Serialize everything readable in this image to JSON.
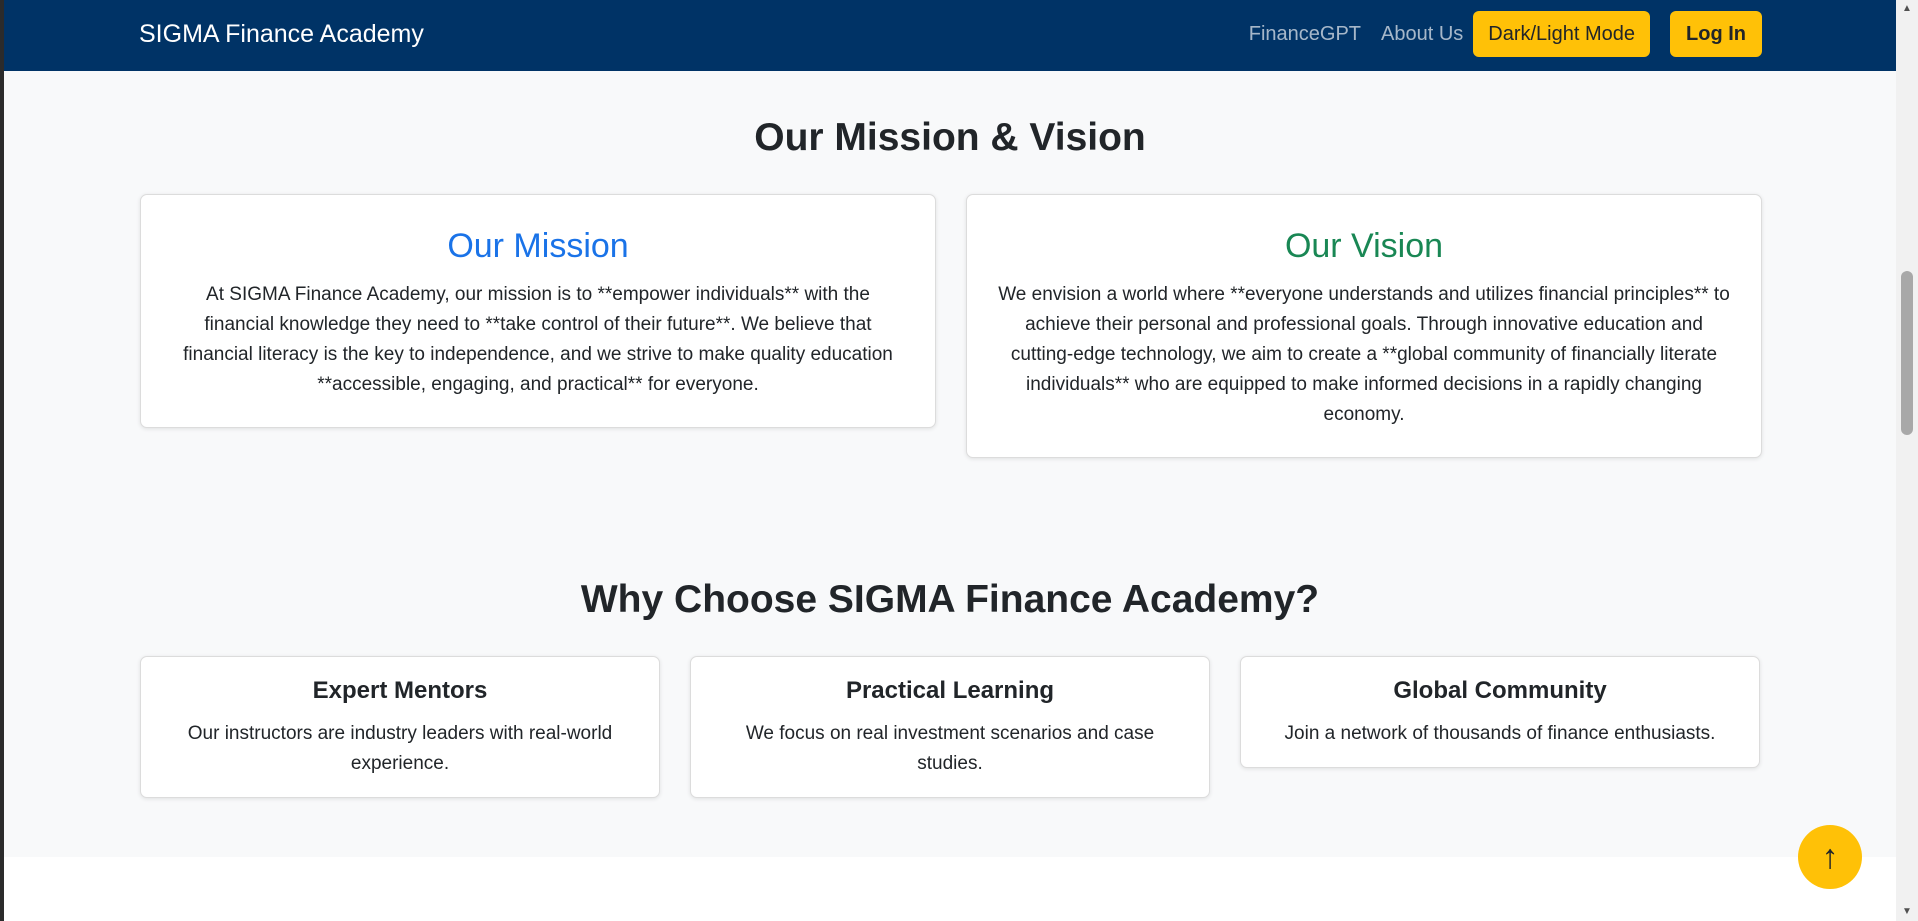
{
  "navbar": {
    "brand": "SIGMA Finance Academy",
    "links": [
      "FinanceGPT",
      "About Us"
    ],
    "theme_button": "Dark/Light Mode",
    "login_button": "Log In"
  },
  "mission_vision": {
    "title": "Our Mission & Vision",
    "mission": {
      "heading": "Our Mission",
      "text": "At SIGMA Finance Academy, our mission is to **empower individuals** with the financial knowledge they need to **take control of their future**. We believe that financial literacy is the key to independence, and we strive to make quality education **accessible, engaging, and practical** for everyone."
    },
    "vision": {
      "heading": "Our Vision",
      "text": "We envision a world where **everyone understands and utilizes financial principles** to achieve their personal and professional goals. Through innovative education and cutting-edge technology, we aim to create a **global community of financially literate individuals** who are equipped to make informed decisions in a rapidly changing economy."
    }
  },
  "why_choose": {
    "title": "Why Choose SIGMA Finance Academy?",
    "features": [
      {
        "heading": "Expert Mentors",
        "text": "Our instructors are industry leaders with real-world experience."
      },
      {
        "heading": "Practical Learning",
        "text": "We focus on real investment scenarios and case studies."
      },
      {
        "heading": "Global Community",
        "text": "Join a network of thousands of finance enthusiasts."
      }
    ]
  },
  "back_to_top": "↑",
  "colors": {
    "navbar": "#003366",
    "accent_yellow": "#ffc107",
    "mission_blue": "#1a73e8",
    "vision_green": "#198754",
    "page_bg": "#f8f9fa"
  },
  "icons": {
    "back_to_top": "arrow-up-icon"
  }
}
